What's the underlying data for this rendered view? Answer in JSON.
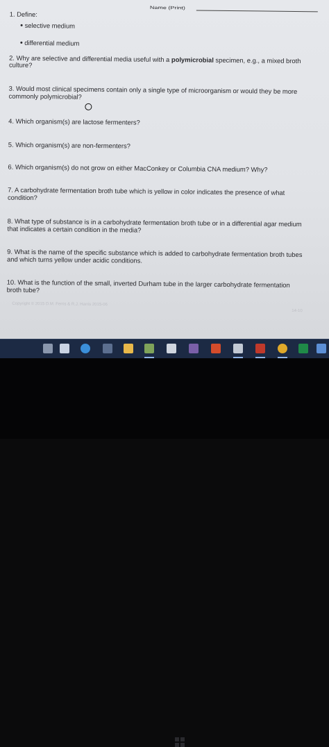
{
  "header": {
    "name_label": "Name (Print)"
  },
  "q1": {
    "text": "1. Define:",
    "items": [
      "selective medium",
      "differential medium"
    ]
  },
  "q2": {
    "line1_before": "2. Why are selective and differential media useful with a ",
    "line1_bold": "polymicrobial",
    "line1_after": " specimen, e.g., a mixed broth",
    "line2": "culture?"
  },
  "q3": {
    "line1": "3. Would most clinical specimens contain only a single type of microorganism or would they be more",
    "line2": "commonly polymicrobial?"
  },
  "q4": {
    "line1": "4. Which organism(s) are lactose fermenters?"
  },
  "q5": {
    "line1": "5. Which organism(s) are non-fermenters?"
  },
  "q6": {
    "line1": "6. Which organism(s) do not grow on either MacConkey or Columbia CNA medium?  Why?"
  },
  "q7": {
    "line1": "7. A carbohydrate fermentation broth tube which is yellow in color indicates the presence of what",
    "line2": "condition?"
  },
  "q8": {
    "line1": "8. What type of substance is in a carbohydrate fermentation broth tube or in a differential agar medium",
    "line2": "that indicates a certain condition in the media?"
  },
  "q9": {
    "line1": "9. What is the name of the specific substance which is added to carbohydrate fermentation broth tubes",
    "line2": "and which turns yellow under acidic conditions."
  },
  "q10": {
    "line1": "10. What is the function of the small, inverted Durham tube in the larger carbohydrate fermentation",
    "line2": "broth tube?"
  },
  "footer": {
    "copyright": "Copyright © 2015 D.M. Ferris & R.J. Harris 2015-06",
    "page": "14-10"
  },
  "taskbar": {
    "icons": [
      "search-icon",
      "task-view-icon",
      "edge-icon",
      "store-icon",
      "file-explorer-icon",
      "photos-icon",
      "settings-icon",
      "app-icon",
      "powerpoint-icon",
      "mail-icon",
      "shield-icon",
      "chrome-icon",
      "excel-icon",
      "desktop-icon"
    ],
    "colors": [
      "#8a97ad",
      "#c9d3e3",
      "#3b8fd9",
      "#5c6f8f",
      "#e8b84a",
      "#7fa35a",
      "#d0d6df",
      "#7a5fa8",
      "#d44c2b",
      "#c2c9d4",
      "#c0392b",
      "#e0a92a",
      "#1f8a48",
      "#5c8fd6"
    ]
  }
}
